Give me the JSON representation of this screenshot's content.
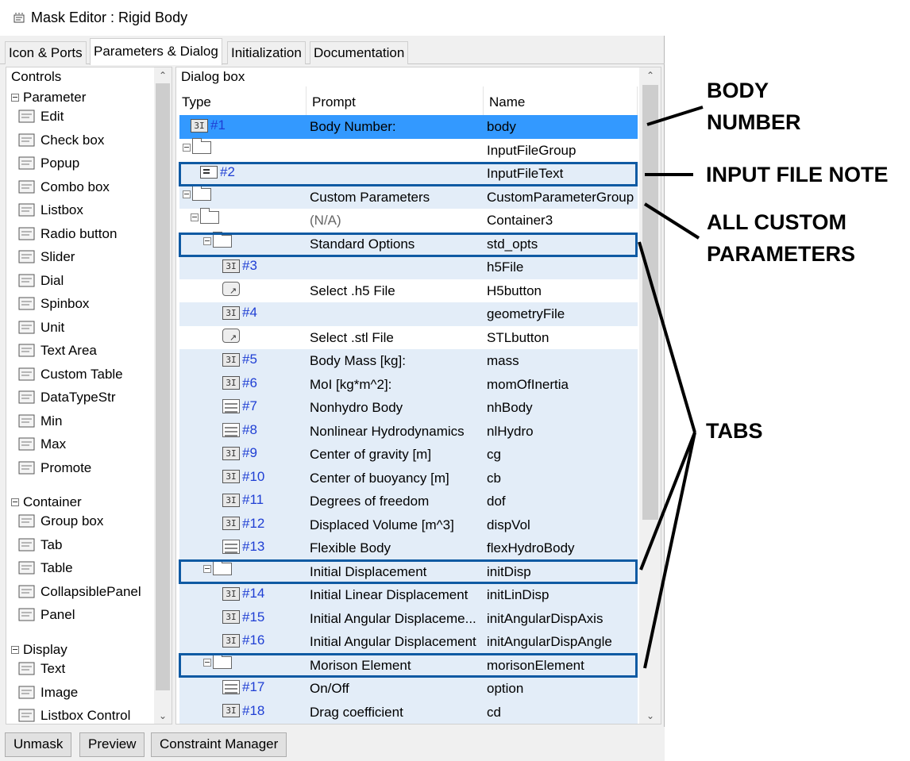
{
  "window": {
    "title": "Mask Editor : Rigid Body",
    "title_icon": "mask-editor-icon"
  },
  "tabs": [
    {
      "label": "Icon & Ports",
      "active": false
    },
    {
      "label": "Parameters & Dialog",
      "active": true
    },
    {
      "label": "Initialization",
      "active": false
    },
    {
      "label": "Documentation",
      "active": false
    }
  ],
  "controls": {
    "header": "Controls",
    "sections": [
      {
        "label": "Parameter",
        "items": [
          "Edit",
          "Check box",
          "Popup",
          "Combo box",
          "Listbox",
          "Radio button",
          "Slider",
          "Dial",
          "Spinbox",
          "Unit",
          "Text Area",
          "Custom Table",
          "DataTypeStr",
          "Min",
          "Max",
          "Promote"
        ]
      },
      {
        "label": "Container",
        "items": [
          "Group box",
          "Tab",
          "Table",
          "CollapsiblePanel",
          "Panel"
        ]
      },
      {
        "label": "Display",
        "items": [
          "Text",
          "Image",
          "Listbox Control"
        ]
      }
    ]
  },
  "dialog": {
    "header": "Dialog box",
    "columns": {
      "type": "Type",
      "prompt": "Prompt",
      "name": "Name"
    },
    "rows": [
      {
        "type": "edit",
        "num": "#1",
        "prompt": "Body Number:",
        "name": "body",
        "selected": true
      },
      {
        "type": "folder",
        "num": "",
        "prompt": "",
        "name": "InputFileGroup"
      },
      {
        "type": "text",
        "num": "#2",
        "prompt": "",
        "name": "InputFileText"
      },
      {
        "type": "folder",
        "num": "",
        "prompt": "Custom Parameters",
        "name": "CustomParameterGroup"
      },
      {
        "type": "folder",
        "num": "",
        "prompt": "(N/A)",
        "name": "Container3"
      },
      {
        "type": "folder",
        "num": "",
        "prompt": "Standard Options",
        "name": "std_opts"
      },
      {
        "type": "edit",
        "num": "#3",
        "prompt": "",
        "name": "h5File"
      },
      {
        "type": "button",
        "num": "",
        "prompt": "Select .h5 File",
        "name": "H5button"
      },
      {
        "type": "edit",
        "num": "#4",
        "prompt": "",
        "name": "geometryFile"
      },
      {
        "type": "button",
        "num": "",
        "prompt": "Select .stl File",
        "name": "STLbutton"
      },
      {
        "type": "edit",
        "num": "#5",
        "prompt": "Body Mass [kg]:",
        "name": "mass"
      },
      {
        "type": "edit",
        "num": "#6",
        "prompt": "MoI [kg*m^2]:",
        "name": "momOfInertia"
      },
      {
        "type": "popup",
        "num": "#7",
        "prompt": "Nonhydro Body",
        "name": "nhBody"
      },
      {
        "type": "popup",
        "num": "#8",
        "prompt": "Nonlinear Hydrodynamics",
        "name": "nlHydro"
      },
      {
        "type": "edit",
        "num": "#9",
        "prompt": "Center of gravity [m]",
        "name": "cg"
      },
      {
        "type": "edit",
        "num": "#10",
        "prompt": "Center of buoyancy [m]",
        "name": "cb"
      },
      {
        "type": "edit",
        "num": "#11",
        "prompt": "Degrees of freedom",
        "name": "dof"
      },
      {
        "type": "edit",
        "num": "#12",
        "prompt": "Displaced Volume [m^3]",
        "name": "dispVol"
      },
      {
        "type": "popup",
        "num": "#13",
        "prompt": "Flexible Body",
        "name": "flexHydroBody"
      },
      {
        "type": "folder",
        "num": "",
        "prompt": "Initial Displacement",
        "name": "initDisp"
      },
      {
        "type": "edit",
        "num": "#14",
        "prompt": "Initial Linear Displacement",
        "name": "initLinDisp"
      },
      {
        "type": "edit",
        "num": "#15",
        "prompt": "Initial Angular Displaceme...",
        "name": "initAngularDispAxis"
      },
      {
        "type": "edit",
        "num": "#16",
        "prompt": "Initial Angular Displacement",
        "name": "initAngularDispAngle"
      },
      {
        "type": "folder",
        "num": "",
        "prompt": "Morison Element",
        "name": "morisonElement"
      },
      {
        "type": "popup",
        "num": "#17",
        "prompt": "On/Off",
        "name": "option"
      },
      {
        "type": "edit",
        "num": "#18",
        "prompt": "Drag coefficient",
        "name": "cd"
      }
    ]
  },
  "buttons": {
    "unmask": "Unmask",
    "preview": "Preview",
    "constraint_manager": "Constraint Manager"
  },
  "annotations": {
    "body_number_1": "BODY",
    "body_number_2": "NUMBER",
    "input_file_note": "INPUT FILE NOTE",
    "all_custom_1": "ALL CUSTOM",
    "all_custom_2": "PARAMETERS",
    "tabs": "TABS"
  },
  "colors": {
    "selected_row": "#3399ff",
    "alt_row": "#e3edf8",
    "highlight_box": "#0f5aa3",
    "index_text": "#1f3fd4"
  }
}
